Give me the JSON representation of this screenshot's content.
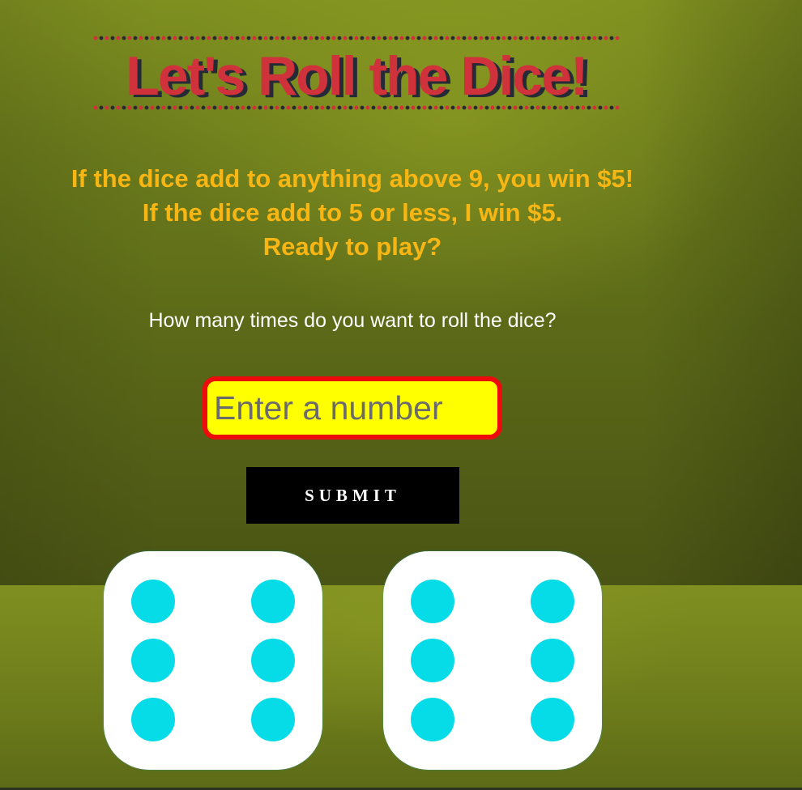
{
  "header": {
    "title": "Let's Roll the Dice!"
  },
  "rules": {
    "line1": "If the dice add to anything above 9, you win $5!",
    "line2": "If the dice add to 5 or less, I win $5.",
    "line3": "Ready to play?"
  },
  "form": {
    "prompt": "How many times do you want to roll the dice?",
    "input_placeholder": "Enter a number",
    "input_value": "",
    "submit_label": "SUBMIT"
  },
  "dice": [
    {
      "value": 6,
      "face_color": "#ffffff",
      "pip_color": "#06dbe8"
    },
    {
      "value": 6,
      "face_color": "#ffffff",
      "pip_color": "#06dbe8"
    }
  ],
  "colors": {
    "title_red": "#d0323c",
    "title_shadow": "#262a36",
    "rules_text": "#f7b614",
    "input_bg": "#ffff00",
    "input_border": "#ee0b0b",
    "button_bg": "#000000",
    "felt_green": "#6c7c1c"
  }
}
